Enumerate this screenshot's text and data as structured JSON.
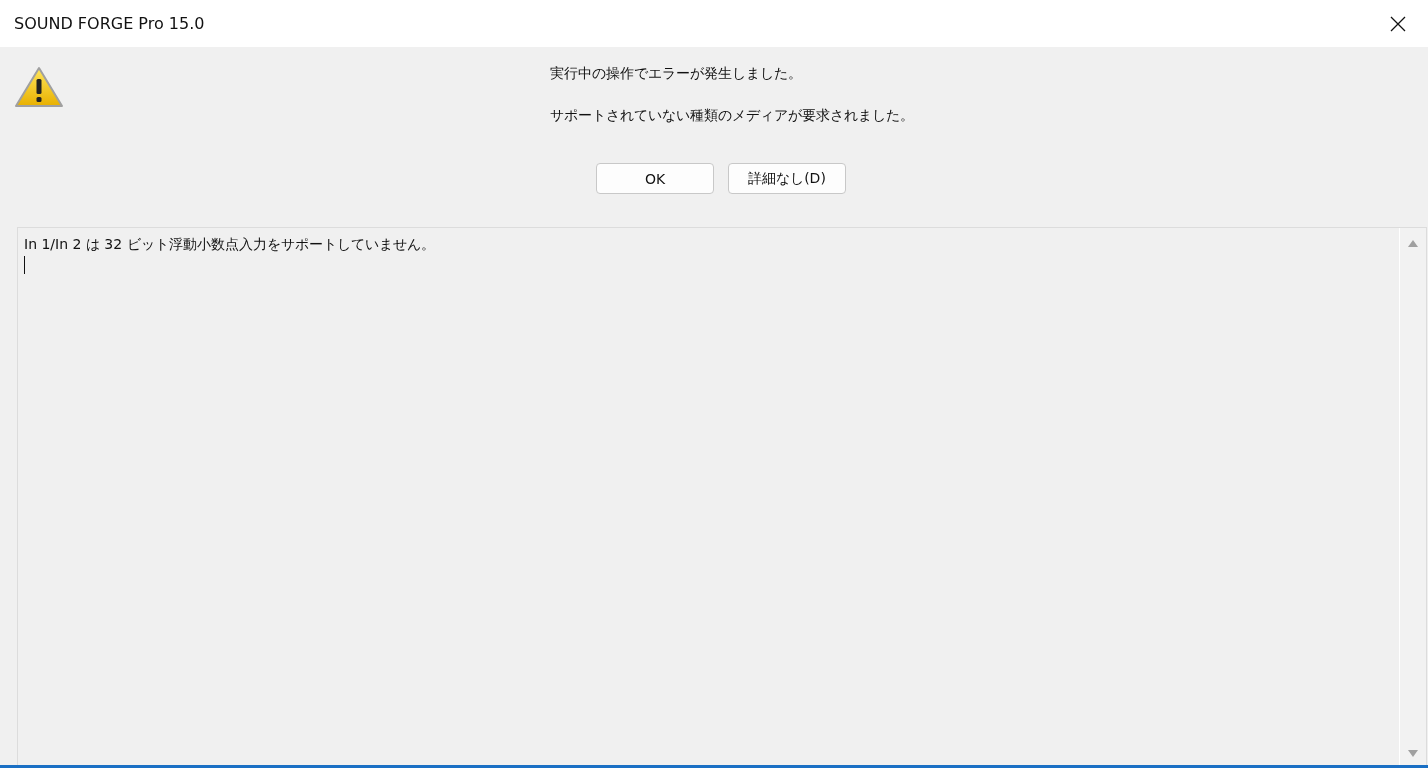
{
  "window": {
    "title": "SOUND FORGE Pro 15.0"
  },
  "messages": [
    "実行中の操作でエラーが発生しました。",
    "サポートされていない種類のメディアが要求されました。"
  ],
  "buttons": [
    "OK",
    "詳細なし(D)"
  ],
  "details": {
    "value": "In 1/In 2 は 32 ビット浮動小数点入力をサポートしていません。"
  }
}
